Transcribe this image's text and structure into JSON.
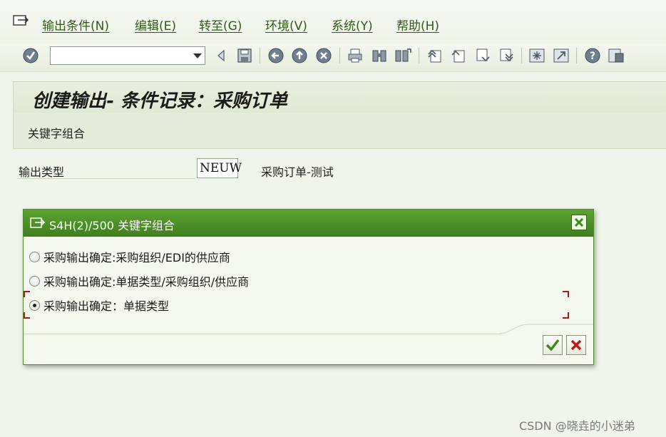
{
  "menu": {
    "items": [
      {
        "label": "输出条件(N)"
      },
      {
        "label": "编辑(E)"
      },
      {
        "label": "转至(G)"
      },
      {
        "label": "环境(V)"
      },
      {
        "label": "系统(Y)"
      },
      {
        "label": "帮助(H)"
      }
    ]
  },
  "toolbar": {
    "command_value": "",
    "icons": [
      "enter-icon",
      "back-icon",
      "save-icon",
      "back-green-icon",
      "exit-icon",
      "cancel-icon",
      "print-icon",
      "find-icon",
      "find-next-icon",
      "first-page-icon",
      "previous-page-icon",
      "next-page-icon",
      "last-page-icon",
      "new-session-icon",
      "shortcut-icon",
      "help-icon",
      "layout-icon"
    ]
  },
  "header": {
    "title": "创建输出- 条件记录：采购订单",
    "subtitle": "关键字组合"
  },
  "form": {
    "output_type_label": "输出类型",
    "output_type_value": "NEUW",
    "output_type_desc": "采购订单-测试"
  },
  "dialog": {
    "title": "S4H(2)/500 关键字组合",
    "options": [
      {
        "label": "采购输出确定:采购组织/EDI的供应商",
        "selected": false
      },
      {
        "label": "采购输出确定:单据类型/采购组织/供应商",
        "selected": false
      },
      {
        "label": "采购输出确定：单据类型",
        "selected": true
      }
    ],
    "colors": {
      "header": "#4b8e25",
      "accent_ok": "#3a8a18",
      "accent_cancel": "#c01818"
    }
  },
  "watermark": "CSDN @晓垚的小迷弟"
}
